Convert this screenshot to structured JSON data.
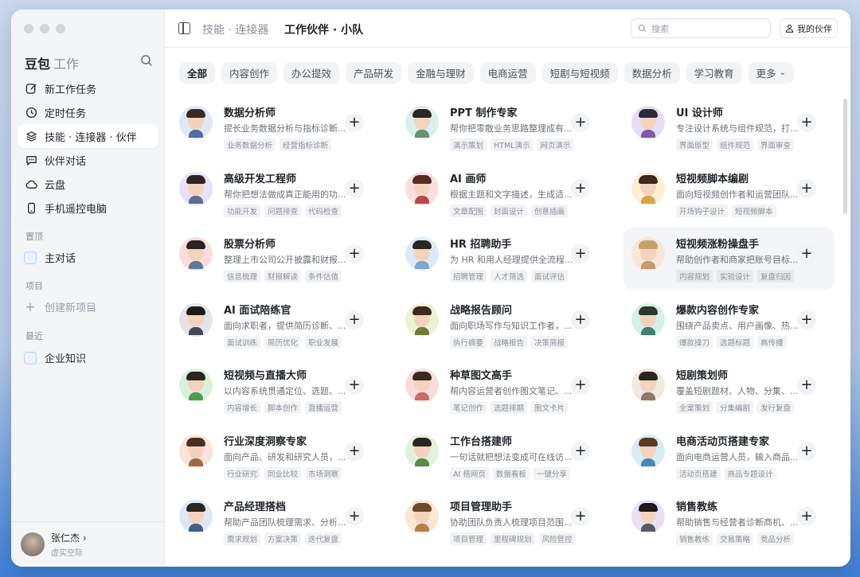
{
  "sidebar": {
    "brand": "豆包",
    "brand_sub": "工作",
    "nav": [
      {
        "label": "新工作任务",
        "icon": "edit-icon"
      },
      {
        "label": "定时任务",
        "icon": "clock-icon"
      },
      {
        "label": "技能 · 连接器 · 伙伴",
        "icon": "layers-icon",
        "active": true
      },
      {
        "label": "伙伴对话",
        "icon": "chat-icon"
      },
      {
        "label": "云盘",
        "icon": "cloud-icon"
      },
      {
        "label": "手机遥控电脑",
        "icon": "phone-icon"
      }
    ],
    "pinned_title": "置顶",
    "pinned_item": "主对话",
    "projects_title": "项目",
    "new_project": "创建新项目",
    "recent_title": "最近",
    "recent_item": "企业知识",
    "user_name": "张仁杰",
    "user_space": "虚实空际"
  },
  "topbar": {
    "breadcrumb_muted": "技能 · 连接器",
    "breadcrumb_current": "工作伙伴 · 小队",
    "search_placeholder": "搜索",
    "my_partner": "我的伙伴"
  },
  "tabs": [
    "全部",
    "内容创作",
    "办公提效",
    "产品研发",
    "金融与理财",
    "电商运营",
    "短剧与短视频",
    "数据分析",
    "学习教育",
    "更多"
  ],
  "cards": [
    {
      "title": "数据分析师",
      "desc": "提长业务数据分析与指标诊断...",
      "tags": [
        "业务数据分析",
        "经营指标诊断"
      ],
      "hair": "#3b2a22",
      "bg": "#dfe8f7",
      "shirt": "#4a6fa5"
    },
    {
      "title": "PPT 制作专家",
      "desc": "帮你把零散业务思路整理成有...",
      "tags": [
        "演示策划",
        "HTML演示",
        "网页演示"
      ],
      "hair": "#2b2522",
      "bg": "#d9f1ee",
      "shirt": "#6b8f71"
    },
    {
      "title": "UI 设计师",
      "desc": "专注设计系统与组件规范，打...",
      "tags": [
        "界面原型",
        "组件规范",
        "界面审查"
      ],
      "hair": "#2d2a3a",
      "bg": "#e6def6",
      "shirt": "#7a5ca8"
    },
    {
      "title": "高级开发工程师",
      "desc": "帮你把想法做成真正能用的功...",
      "tags": [
        "功能开发",
        "问题排查",
        "代码检查"
      ],
      "hair": "#2b2522",
      "bg": "#e9e1f7",
      "shirt": "#5b6e8c"
    },
    {
      "title": "AI 画师",
      "desc": "根据主题和文字描述，生成适...",
      "tags": [
        "文章配图",
        "封面设计",
        "创意插画"
      ],
      "hair": "#5a2a22",
      "bg": "#f9dfe0",
      "shirt": "#b94848"
    },
    {
      "title": "短视频脚本编剧",
      "desc": "面向短视频创作者和运营团队...",
      "tags": [
        "开场钩子设计",
        "短视频脚本"
      ],
      "hair": "#3a2a20",
      "bg": "#fbefd6",
      "shirt": "#d6a54a"
    },
    {
      "title": "股票分析师",
      "desc": "整理上市公司公开披露和财报...",
      "tags": [
        "信息梳理",
        "财报解读",
        "条件估值"
      ],
      "hair": "#2b2522",
      "bg": "#fadcdc",
      "shirt": "#5b7a99"
    },
    {
      "title": "HR 招聘助手",
      "desc": "为 HR 和用人经理提供全流程...",
      "tags": [
        "招聘管理",
        "人才筛选",
        "面试评估"
      ],
      "hair": "#2b2522",
      "bg": "#dceaf8",
      "shirt": "#7fa7cf"
    },
    {
      "title": "短视频涨粉操盘手",
      "desc": "帮助创作者和商家把账号目标...",
      "tags": [
        "内容规划",
        "实验设计",
        "复盘归因"
      ],
      "hair": "#c9a06a",
      "bg": "#f6e7d8",
      "shirt": "#c79a6b",
      "highlight": true
    },
    {
      "title": "AI 面试陪练官",
      "desc": "面向求职者，提供简历诊断、...",
      "tags": [
        "面试训练",
        "简历优化",
        "职业发展"
      ],
      "hair": "#1f1a18",
      "bg": "#e3e3e8",
      "shirt": "#444a55"
    },
    {
      "title": "战略报告顾问",
      "desc": "面向职场写作与知识工作者，...",
      "tags": [
        "执行摘要",
        "战略报告",
        "决策简报"
      ],
      "hair": "#3a2a20",
      "bg": "#eef2cf",
      "shirt": "#6d7a3b"
    },
    {
      "title": "爆款内容创作专家",
      "desc": "围绕产品卖点、用户画像、热...",
      "tags": [
        "爆款操刀",
        "选题标题",
        "高传播"
      ],
      "hair": "#2b3a2a",
      "bg": "#d5efe9",
      "shirt": "#3f7f6f"
    },
    {
      "title": "短视频与直播大师",
      "desc": "以内容系统贯通定位、选题、...",
      "tags": [
        "内容增长",
        "脚本创作",
        "直播运营"
      ],
      "hair": "#2b2522",
      "bg": "#d9f1da",
      "shirt": "#4c9a55"
    },
    {
      "title": "种草图文高手",
      "desc": "帮内容运营者创作图文笔记、...",
      "tags": [
        "笔记创作",
        "选题排期",
        "图文卡片"
      ],
      "hair": "#3a2a20",
      "bg": "#fadcdc",
      "shirt": "#c96b6b"
    },
    {
      "title": "短剧策划师",
      "desc": "覆盖短剧题材、人物、分集、...",
      "tags": [
        "全案策划",
        "分集编剧",
        "发行复盘"
      ],
      "hair": "#2b2522",
      "bg": "#efe9df",
      "shirt": "#8a7a6a"
    },
    {
      "title": "行业深度洞察专家",
      "desc": "面向产品、研发和研究人员，...",
      "tags": [
        "行业研究",
        "同业比较",
        "市场洞察"
      ],
      "hair": "#4a2e22",
      "bg": "#fbe3d8",
      "shirt": "#9a6a4a"
    },
    {
      "title": "工作台搭建师",
      "desc": "一句话就把想法变成可在线访...",
      "tags": [
        "AI 搭网页",
        "数据看板",
        "一键分享"
      ],
      "hair": "#2b2522",
      "bg": "#dff3dc",
      "shirt": "#5a8a4a"
    },
    {
      "title": "电商活动页搭建专家",
      "desc": "面向电商运营人员，输入商品...",
      "tags": [
        "活动页搭建",
        "商品专题设计"
      ],
      "hair": "#5a3a22",
      "bg": "#d6ecf6",
      "shirt": "#4a8ab0"
    },
    {
      "title": "产品经理搭档",
      "desc": "帮助产品团队梳理需求、分析...",
      "tags": [
        "需求规划",
        "方案决策",
        "迭代复盘"
      ],
      "hair": "#2b2522",
      "bg": "#dce8f6",
      "shirt": "#3f5f8a"
    },
    {
      "title": "项目管理助手",
      "desc": "协助团队负责人梳理项目范围...",
      "tags": [
        "项目管理",
        "里程碑规划",
        "风险管控"
      ],
      "hair": "#6a4a2a",
      "bg": "#fbe6d2",
      "shirt": "#b0834a"
    },
    {
      "title": "销售教练",
      "desc": "帮助销售与经营者诊断商机、...",
      "tags": [
        "销售教练",
        "交易策略",
        "竞品分析"
      ],
      "hair": "#1f1a18",
      "bg": "#e8e1f6",
      "shirt": "#555a66"
    }
  ],
  "add_label": "+"
}
